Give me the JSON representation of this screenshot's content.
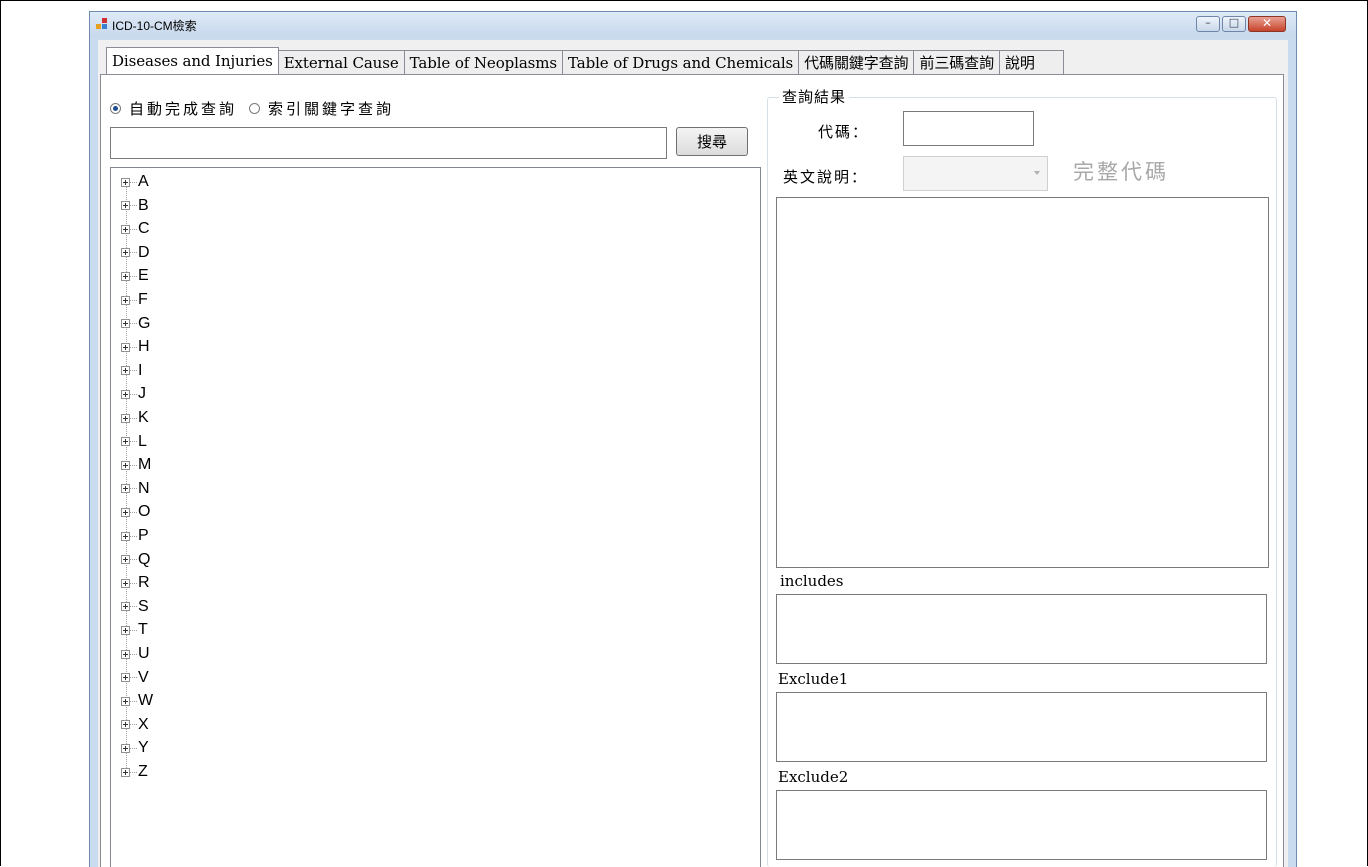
{
  "window": {
    "title": "ICD-10-CM檢索",
    "minimize_glyph": "–",
    "maximize_glyph": "□",
    "close_glyph": "✕"
  },
  "tabs": [
    {
      "label": "Diseases and Injuries",
      "active": true
    },
    {
      "label": "External Cause",
      "active": false
    },
    {
      "label": "Table of Neoplasms",
      "active": false
    },
    {
      "label": "Table of Drugs and Chemicals",
      "active": false
    },
    {
      "label": "代碼關鍵字查詢",
      "active": false
    },
    {
      "label": "前三碼查詢",
      "active": false
    },
    {
      "label": "說明",
      "active": false
    }
  ],
  "search": {
    "mode_autocomplete_label": "自動完成查詢",
    "mode_index_keyword_label": "索引關鍵字查詢",
    "selected_mode": "自動完成查詢",
    "input_value": "",
    "button_label": "搜尋"
  },
  "tree": {
    "nodes": [
      "A",
      "B",
      "C",
      "D",
      "E",
      "F",
      "G",
      "H",
      "I",
      "J",
      "K",
      "L",
      "M",
      "N",
      "O",
      "P",
      "Q",
      "R",
      "S",
      "T",
      "U",
      "V",
      "W",
      "X",
      "Y",
      "Z"
    ]
  },
  "result": {
    "group_title": "查詢結果",
    "code_label": "代碼：",
    "code_value": "",
    "english_label": "英文說明：",
    "english_value": "",
    "full_code_label": "完整代碼",
    "includes_label": "includes",
    "exclude1_label": "Exclude1",
    "exclude2_label": "Exclude2"
  },
  "colors": {
    "title_bar": "#c9dbee",
    "close_button": "#c7442c",
    "radio_selected": "#1f4e90",
    "disabled_text": "#a8a8a8"
  }
}
